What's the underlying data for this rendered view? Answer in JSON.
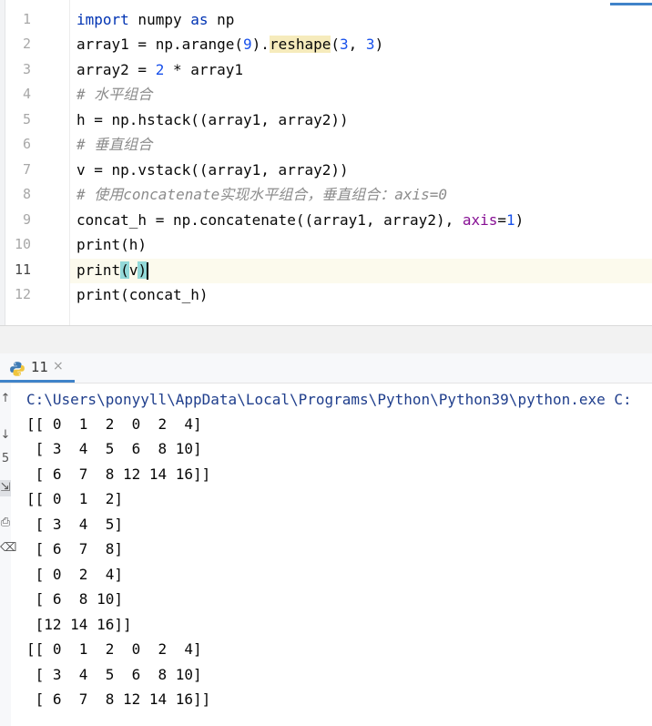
{
  "editor": {
    "line_numbers": [
      "1",
      "2",
      "3",
      "4",
      "5",
      "6",
      "7",
      "8",
      "9",
      "10",
      "11",
      "12"
    ],
    "current_line_number": "11",
    "lines": [
      {
        "k1": "import",
        "t1": " numpy ",
        "k2": "as",
        "t2": " np"
      },
      {
        "a": "array1 = np.arange(",
        "n1": "9",
        "b": ").",
        "m": "reshape",
        "c": "(",
        "n2": "3",
        "d": ", ",
        "n3": "3",
        "e": ")"
      },
      {
        "a": "array2 = ",
        "n1": "2",
        "b": " * array1"
      },
      {
        "comment": "# 水平组合"
      },
      {
        "text": "h = np.hstack((array1, array2))"
      },
      {
        "comment": "# 垂直组合"
      },
      {
        "text": "v = np.vstack((array1, array2))"
      },
      {
        "comment": "# 使用concatenate实现水平组合，垂直组合：axis=0"
      },
      {
        "a": "concat_h = np.concatenate((array1, array2), ",
        "kw": "axis",
        "eq": "=",
        "n1": "1",
        "b": ")"
      },
      {
        "text": "print(h)"
      },
      {
        "a": "print",
        "p1": "(",
        "v": "v",
        "p2": ")"
      },
      {
        "text": "print(concat_h)"
      }
    ]
  },
  "run_tab": {
    "label": "11",
    "close_glyph": "×",
    "icon": "python-icon"
  },
  "console": {
    "toolbar_icons": [
      "up-arrow-icon",
      "down-arrow-icon",
      "wrap-icon",
      "soft-wrap-icon",
      "print-icon",
      "trash-icon"
    ],
    "path_line": "C:\\Users\\ponyyll\\AppData\\Local\\Programs\\Python\\Python39\\python.exe C:",
    "output_lines": [
      "[[ 0  1  2  0  2  4]",
      " [ 3  4  5  6  8 10]",
      " [ 6  7  8 12 14 16]]",
      "[[ 0  1  2]",
      " [ 3  4  5]",
      " [ 6  7  8]",
      " [ 0  2  4]",
      " [ 6  8 10]",
      " [12 14 16]]",
      "[[ 0  1  2  0  2  4]",
      " [ 3  4  5  6  8 10]",
      " [ 6  7  8 12 14 16]]"
    ]
  },
  "colors": {
    "keyword": "#0033b3",
    "number": "#1750eb",
    "comment": "#8c8c8c",
    "named_arg": "#871094",
    "caret_row": "#fcfaed",
    "brace_match": "#93d9d9",
    "method_highlight": "#f6ebbc",
    "console_path": "#1f3e8c"
  }
}
